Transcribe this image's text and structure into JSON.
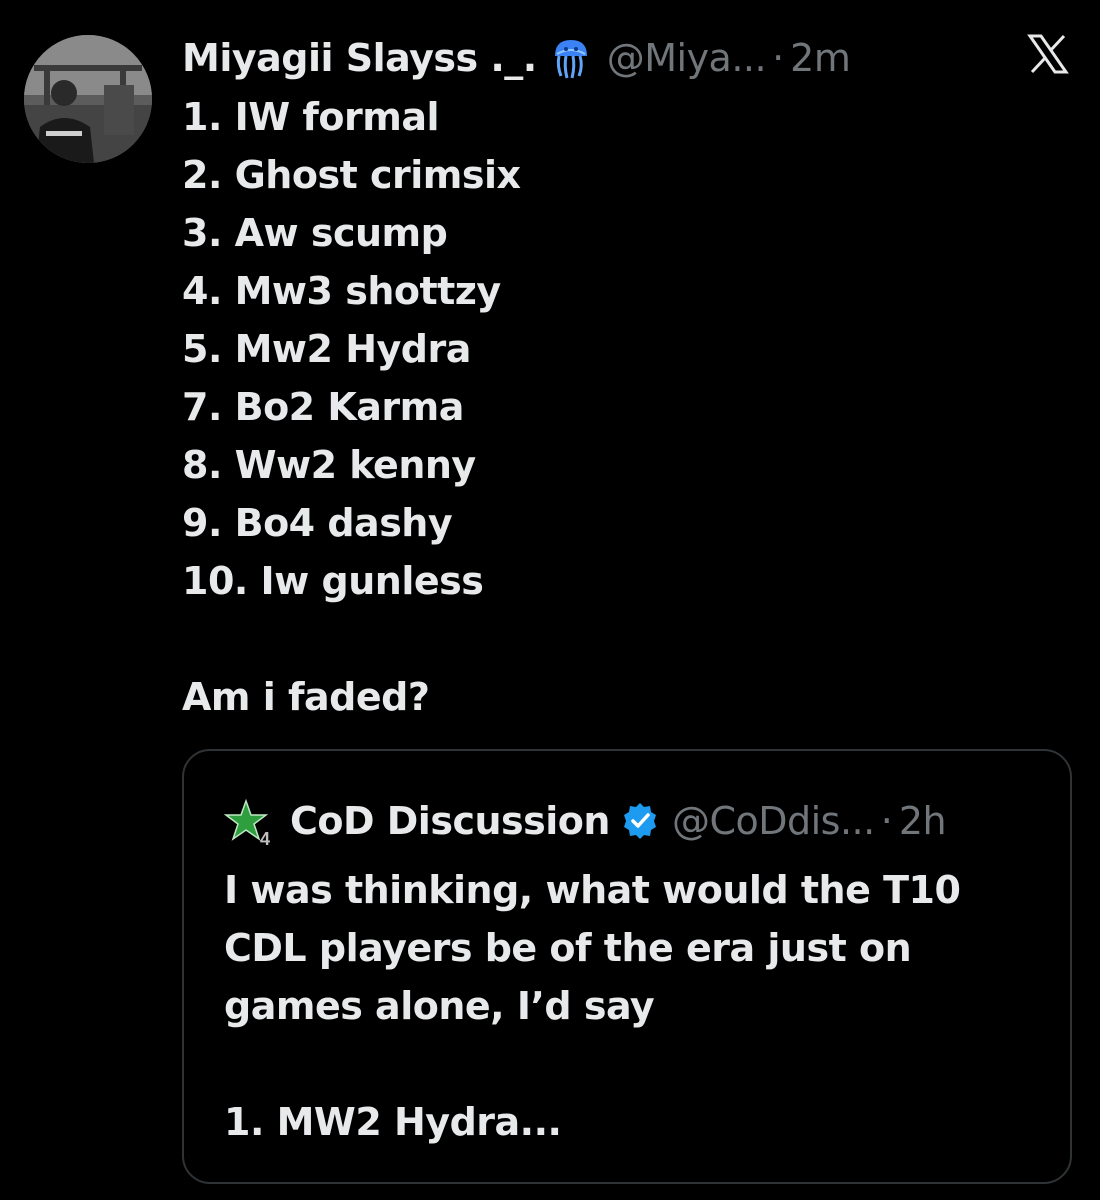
{
  "tweet": {
    "author": {
      "display_name": "Miyagii Slayss ._.",
      "emoji_badge": "jellyfish-icon",
      "handle": "@Miya...",
      "separator": "·",
      "time": "2m"
    },
    "close_icon": "x-logo-icon",
    "list_items": [
      "1. IW formal",
      "2. Ghost crimsix",
      "3. Aw scump",
      "4. Mw3 shottzy",
      "5. Mw2 Hydra",
      "7. Bo2 Karma",
      "8. Ww2 kenny",
      "9. Bo4 dashy",
      "10. Iw gunless"
    ],
    "question": "Am i faded?"
  },
  "quoted_tweet": {
    "author": {
      "display_name": "CoD Discussion",
      "verified_icon": "verified-badge-icon",
      "handle": "@CoDdis...",
      "separator": "·",
      "time": "2h"
    },
    "text_lines": [
      "I was thinking, what would the T10",
      "CDL players be of the era just on",
      "games alone, I’d say"
    ],
    "preview_item": "1. MW2 Hydra..."
  },
  "colors": {
    "background": "#000000",
    "primary_text": "#e7e9ea",
    "secondary_text": "#71767b",
    "border": "#2f3336",
    "verified_blue": "#1d9bf0",
    "star_green": "#2e9e3e"
  }
}
